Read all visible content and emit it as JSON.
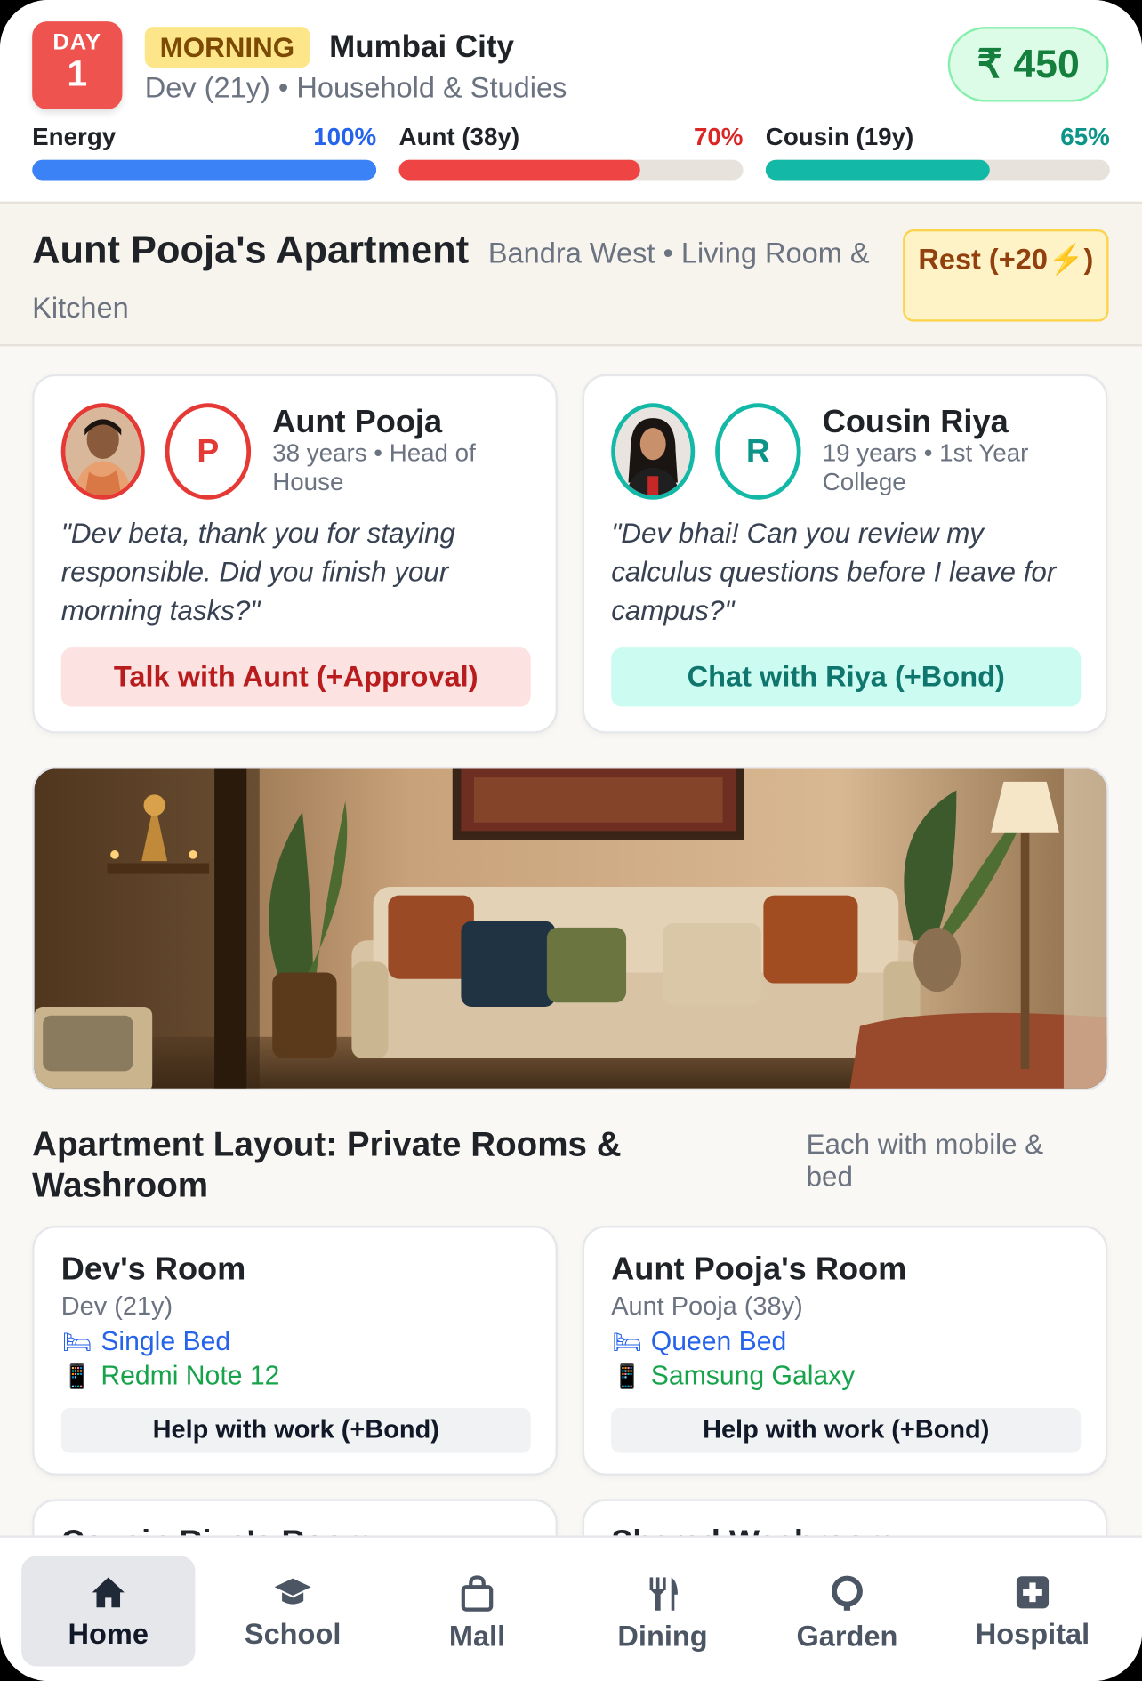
{
  "header": {
    "day_label": "DAY",
    "day_number": "1",
    "time_of_day": "MORNING",
    "city": "Mumbai City",
    "subtitle": "Dev (21y) • Household & Studies",
    "money": "₹ 450",
    "stats": [
      {
        "label": "Energy",
        "value_text": "100%",
        "value": 100,
        "color": "#3b82f6"
      },
      {
        "label": "Aunt (38y)",
        "value_text": "70%",
        "value": 70,
        "color": "#ef4444"
      },
      {
        "label": "Cousin (19y)",
        "value_text": "65%",
        "value": 65,
        "color": "#14b8a6"
      }
    ]
  },
  "location": {
    "title": "Aunt Pooja's Apartment",
    "subtitle": "Bandra West • Living Room & Kitchen",
    "rest_label": "Rest (+20⚡)"
  },
  "characters": [
    {
      "name": "Aunt Pooja",
      "initial": "P",
      "meta": "38 years • Head of House",
      "quote": "\"Dev beta, thank you for staying responsible. Did you finish your morning tasks?\"",
      "action": "Talk with Aunt (+Approval)",
      "accent": "#e53935"
    },
    {
      "name": "Cousin Riya",
      "initial": "R",
      "meta": "19 years • 1st Year College",
      "quote": "\"Dev bhai! Can you review my calculus questions before I leave for campus?\"",
      "action": "Chat with Riya (+Bond)",
      "accent": "#14b8a6"
    }
  ],
  "layout_section": {
    "title": "Apartment Layout: Private Rooms & Washroom",
    "note": "Each with mobile & bed"
  },
  "rooms": [
    {
      "name": "Dev's Room",
      "owner": "Dev (21y)",
      "bed": "Single Bed",
      "phone": "Redmi Note 12",
      "help": "Help with work (+Bond)"
    },
    {
      "name": "Aunt Pooja's Room",
      "owner": "Aunt Pooja (38y)",
      "bed": "Queen Bed",
      "phone": "Samsung Galaxy",
      "help": "Help with work (+Bond)"
    },
    {
      "name": "Cousin Riya's Room"
    },
    {
      "name": "Shared Washroom"
    }
  ],
  "nav": [
    {
      "label": "Home",
      "icon": "home-icon",
      "active": true
    },
    {
      "label": "School",
      "icon": "graduation-cap-icon",
      "active": false
    },
    {
      "label": "Mall",
      "icon": "shopping-bag-icon",
      "active": false
    },
    {
      "label": "Dining",
      "icon": "utensils-icon",
      "active": false
    },
    {
      "label": "Garden",
      "icon": "garden-icon",
      "active": false
    },
    {
      "label": "Hospital",
      "icon": "hospital-icon",
      "active": false
    }
  ]
}
